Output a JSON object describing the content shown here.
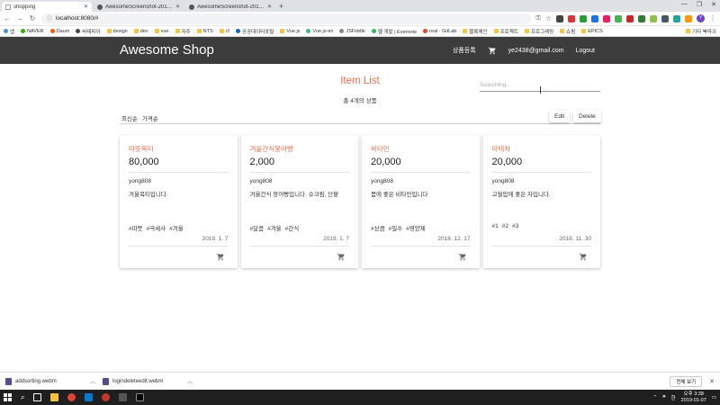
{
  "browser": {
    "tabs": [
      {
        "title": "shopping",
        "active": true
      },
      {
        "title": "AwesomeScreenshot-2019-01-0",
        "active": false
      },
      {
        "title": "AwesomeScreenshot-2019-01-0",
        "active": false
      }
    ],
    "url": "localhost:8080/#",
    "bookmarks": [
      "앱",
      "NAVER",
      "Daum",
      "버테피아",
      "design",
      "dev",
      "vue",
      "자주",
      "NTS",
      "cf",
      "공공데이터포털",
      "Vue.js",
      "Vue.js-en",
      "JSFiddle",
      "웹 개발 | Evernote",
      "real · GitLab",
      "블록체인",
      "프로젝트",
      "프로그래밍",
      "쇼핑",
      "EPICS"
    ],
    "bookmarks_other": "기타 북마크",
    "profile_letter": "Y"
  },
  "header": {
    "brand": "Awesome Shop",
    "nav_register": "상품등록",
    "nav_email": "ye2438@gmail.com",
    "nav_logout": "Logout"
  },
  "main": {
    "title": "Item List",
    "subtitle": "총 4개의 상품",
    "search_placeholder": "Searching...",
    "sort_latest": "최신순",
    "sort_price": "가격순",
    "edit_label": "Edit",
    "delete_label": "Delete",
    "accent_color": "#f26d50"
  },
  "items": [
    {
      "name": "따뜻목티",
      "price": "80,000",
      "seller": "yong808",
      "desc": "겨울목티입니다.",
      "tags": [
        "#따뜻",
        "#극세사",
        "#겨울"
      ],
      "date": "2019. 1. 7"
    },
    {
      "name": "겨울간식붕어빵",
      "price": "2,000",
      "seller": "yong808",
      "desc": "겨울간식 붕어빵입니다. 슈크림, 단팥",
      "tags": [
        "#달콤",
        "#겨울",
        "#간식"
      ],
      "date": "2019. 1. 7"
    },
    {
      "name": "비타민",
      "price": "20,000",
      "seller": "yong808",
      "desc": "몸에 좋은 비타민입니다",
      "tags": [
        "#상큼",
        "#필수",
        "#영양제"
      ],
      "date": "2018. 12. 17"
    },
    {
      "name": "마테차",
      "price": "20,000",
      "seller": "yong808",
      "desc": "고혈압에 좋은 차입니다.",
      "tags": [
        "#1",
        "#2",
        "#3"
      ],
      "date": "2018. 11. 30"
    }
  ],
  "downloads": [
    {
      "file": "addsorting.webm"
    },
    {
      "file": "logindeleteedit.webm"
    }
  ],
  "downloads_showall": "전체 보기",
  "taskbar": {
    "time": "오후 3:38",
    "date": "2019-01-07"
  }
}
